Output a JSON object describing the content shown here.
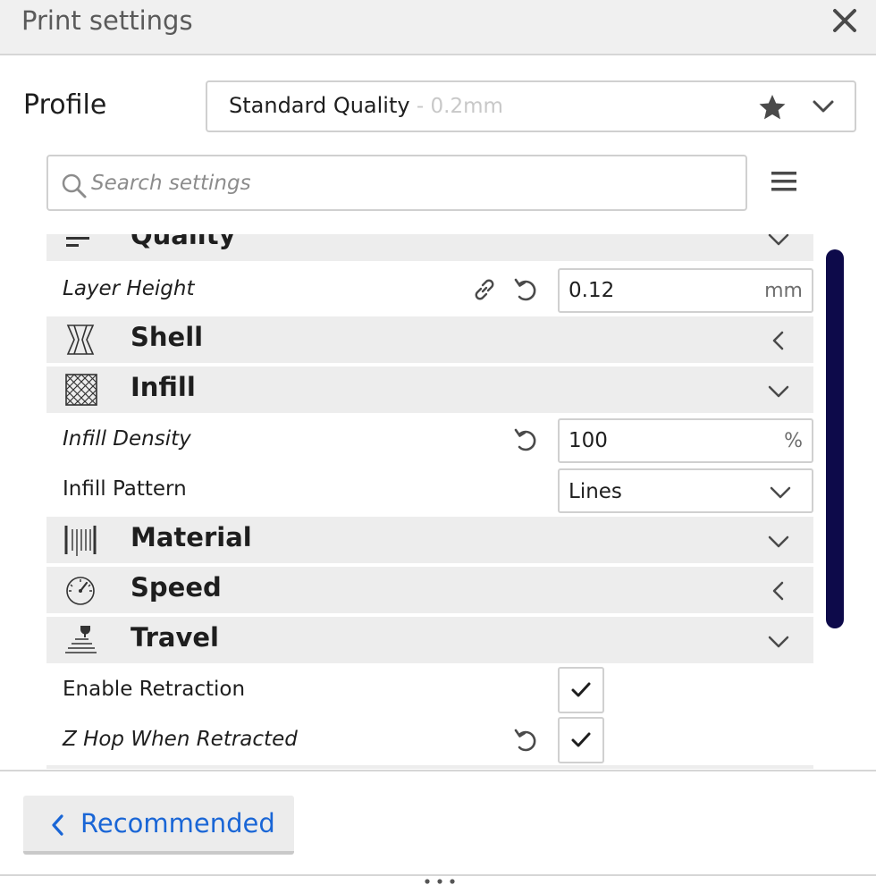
{
  "window": {
    "title": "Print settings",
    "close_icon": "close-icon"
  },
  "profile": {
    "label": "Profile",
    "name": "Standard Quality",
    "sub": " - 0.2mm",
    "star_icon": "star-icon",
    "chevron_icon": "chevron-down-icon"
  },
  "search": {
    "placeholder": "Search settings",
    "value": "",
    "icon": "search-icon",
    "menu_icon": "menu-icon"
  },
  "categories": {
    "quality": {
      "label": "Quality",
      "icon": "quality-icon",
      "state": "expanded"
    },
    "shell": {
      "label": "Shell",
      "icon": "shell-icon",
      "state": "collapsed"
    },
    "infill": {
      "label": "Infill",
      "icon": "infill-icon",
      "state": "expanded"
    },
    "material": {
      "label": "Material",
      "icon": "material-icon",
      "state": "expanded"
    },
    "speed": {
      "label": "Speed",
      "icon": "speed-icon",
      "state": "collapsed"
    },
    "travel": {
      "label": "Travel",
      "icon": "travel-icon",
      "state": "expanded"
    }
  },
  "settings": {
    "layer_height": {
      "label": "Layer Height",
      "value": "0.12",
      "unit": "mm"
    },
    "infill_density": {
      "label": "Infill Density",
      "value": "100",
      "unit": "%"
    },
    "infill_pattern": {
      "label": "Infill Pattern",
      "value": "Lines"
    },
    "enable_retraction": {
      "label": "Enable Retraction",
      "checked": true
    },
    "z_hop": {
      "label": "Z Hop When Retracted",
      "checked": true
    }
  },
  "footer": {
    "recommended_label": "Recommended"
  },
  "colors": {
    "accent": "#1a66d6",
    "scrollbar": "#0d0a4a",
    "category_bg": "#ededed"
  }
}
